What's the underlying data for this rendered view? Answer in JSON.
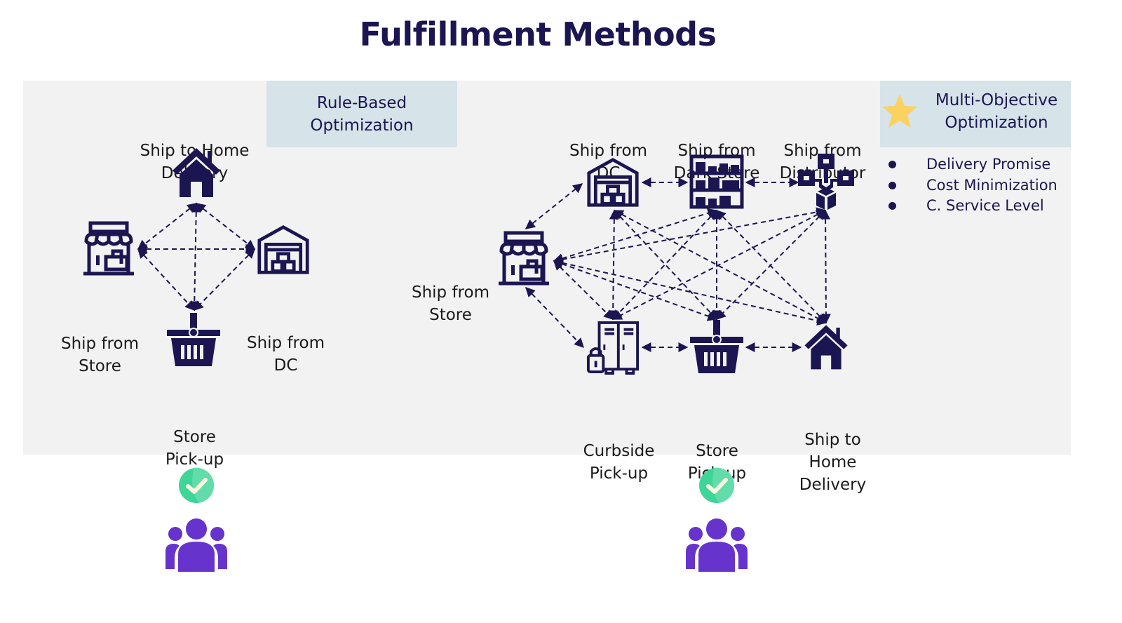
{
  "title": "Fulfillment Methods",
  "colors": {
    "title": "#1b1651",
    "icon": "#1b1651",
    "panel": "#f2f2f2",
    "optimization_box": "#d6e3e9",
    "check_green": "#3dd598",
    "people_purple": "#6633cc",
    "star": "#fbd160"
  },
  "rule_based": {
    "box_label_line1": "Rule-Based",
    "box_label_line2": "Optimization",
    "nodes": {
      "home": {
        "line1": "Ship to Home",
        "line2": "Delivery",
        "icon": "house-icon"
      },
      "store": {
        "line1": "Ship from",
        "line2": "Store",
        "icon": "storefront-icon"
      },
      "dc": {
        "line1": "Ship from",
        "line2": "DC",
        "icon": "warehouse-icon"
      },
      "pickup": {
        "line1": "Store",
        "line2": "Pick-up",
        "icon": "basket-icon"
      }
    },
    "connections": [
      [
        "home",
        "store"
      ],
      [
        "home",
        "dc"
      ],
      [
        "home",
        "pickup"
      ],
      [
        "store",
        "dc"
      ],
      [
        "store",
        "pickup"
      ],
      [
        "dc",
        "pickup"
      ]
    ],
    "status_icon": "check-circle-icon",
    "audience_icon": "people-group-icon"
  },
  "multi_objective": {
    "box_label_line1": "Multi-Objective",
    "box_label_line2": "Optimization",
    "box_icon": "star-icon",
    "objectives": [
      "Delivery Promise",
      "Cost Minimization",
      "C. Service Level"
    ],
    "nodes": {
      "dc": {
        "line1": "Ship from",
        "line2": "DC",
        "icon": "warehouse-icon"
      },
      "dark": {
        "line1": "Ship from",
        "line2": "Dark Store",
        "icon": "shelving-icon"
      },
      "dist": {
        "line1": "Ship from",
        "line2": "Distributor",
        "icon": "distribution-network-icon"
      },
      "store": {
        "line1": "Ship from",
        "line2": "Store",
        "icon": "storefront-icon"
      },
      "curb": {
        "line1": "Curbside",
        "line2": "Pick-up",
        "icon": "locker-icon"
      },
      "pickup": {
        "line1": "Store",
        "line2": "Pick-up",
        "icon": "basket-icon"
      },
      "home": {
        "line1": "Ship to",
        "line2": "Home",
        "line3": "Delivery",
        "icon": "house-icon"
      }
    },
    "connections": [
      [
        "dc",
        "dark"
      ],
      [
        "dark",
        "dist"
      ],
      [
        "store",
        "dc"
      ],
      [
        "store",
        "dark"
      ],
      [
        "store",
        "dist"
      ],
      [
        "store",
        "curb"
      ],
      [
        "store",
        "pickup"
      ],
      [
        "store",
        "home"
      ],
      [
        "store",
        "curb_side"
      ],
      [
        "dc",
        "curb"
      ],
      [
        "dc",
        "pickup"
      ],
      [
        "dc",
        "home"
      ],
      [
        "dark",
        "curb"
      ],
      [
        "dark",
        "pickup"
      ],
      [
        "dark",
        "home"
      ],
      [
        "dist",
        "curb"
      ],
      [
        "dist",
        "pickup"
      ],
      [
        "dist",
        "home"
      ],
      [
        "curb",
        "pickup"
      ],
      [
        "pickup",
        "home"
      ]
    ],
    "status_icon": "check-circle-icon",
    "audience_icon": "people-group-icon"
  }
}
